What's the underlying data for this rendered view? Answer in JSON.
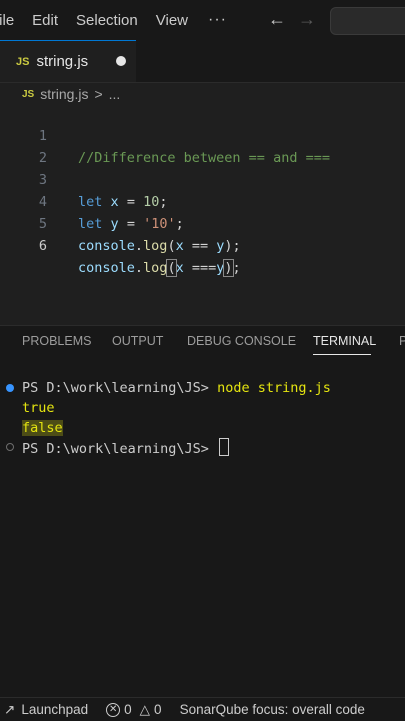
{
  "menubar": {
    "items": [
      "File",
      "Edit",
      "Selection",
      "View"
    ],
    "more": "···"
  },
  "tab": {
    "badge": "JS",
    "label": "string.js",
    "unsaved": true
  },
  "breadcrumb": {
    "badge": "JS",
    "file": "string.js",
    "separator": ">",
    "more": "..."
  },
  "editor": {
    "line_numbers": [
      "1",
      "2",
      "3",
      "4",
      "5",
      "6"
    ],
    "lines": {
      "l1": "//Difference between == and ===",
      "l3": {
        "kw": "let",
        "var": "x",
        "op": "=",
        "val": "10",
        "end": ";"
      },
      "l4": {
        "kw": "let",
        "var": "y",
        "op": "=",
        "val": "'10'",
        "end": ";"
      },
      "l5": {
        "obj": "console",
        "fn": "log",
        "a": "x",
        "op": "==",
        "b": "y"
      },
      "l6": {
        "obj": "console",
        "fn": "log",
        "a": "x",
        "op": "===",
        "b": "y"
      }
    }
  },
  "panel": {
    "tabs": [
      "PROBLEMS",
      "OUTPUT",
      "DEBUG CONSOLE",
      "TERMINAL",
      "P"
    ],
    "active_tab": "TERMINAL"
  },
  "terminal": {
    "prompt1": "PS D:\\work\\learning\\JS>",
    "command": "node string.js",
    "out1": "true",
    "out2": "false",
    "prompt2": "PS D:\\work\\learning\\JS>"
  },
  "statusbar": {
    "launchpad": "Launchpad",
    "errors": "0",
    "warnings": "0",
    "sonar": "SonarQube focus: overall code"
  },
  "colors": {
    "background": "#1f1f1f",
    "keyword": "#569cd6",
    "string": "#ce9178",
    "function": "#dcdcaa",
    "comment": "#6a9955",
    "accent": "#0078d4"
  }
}
